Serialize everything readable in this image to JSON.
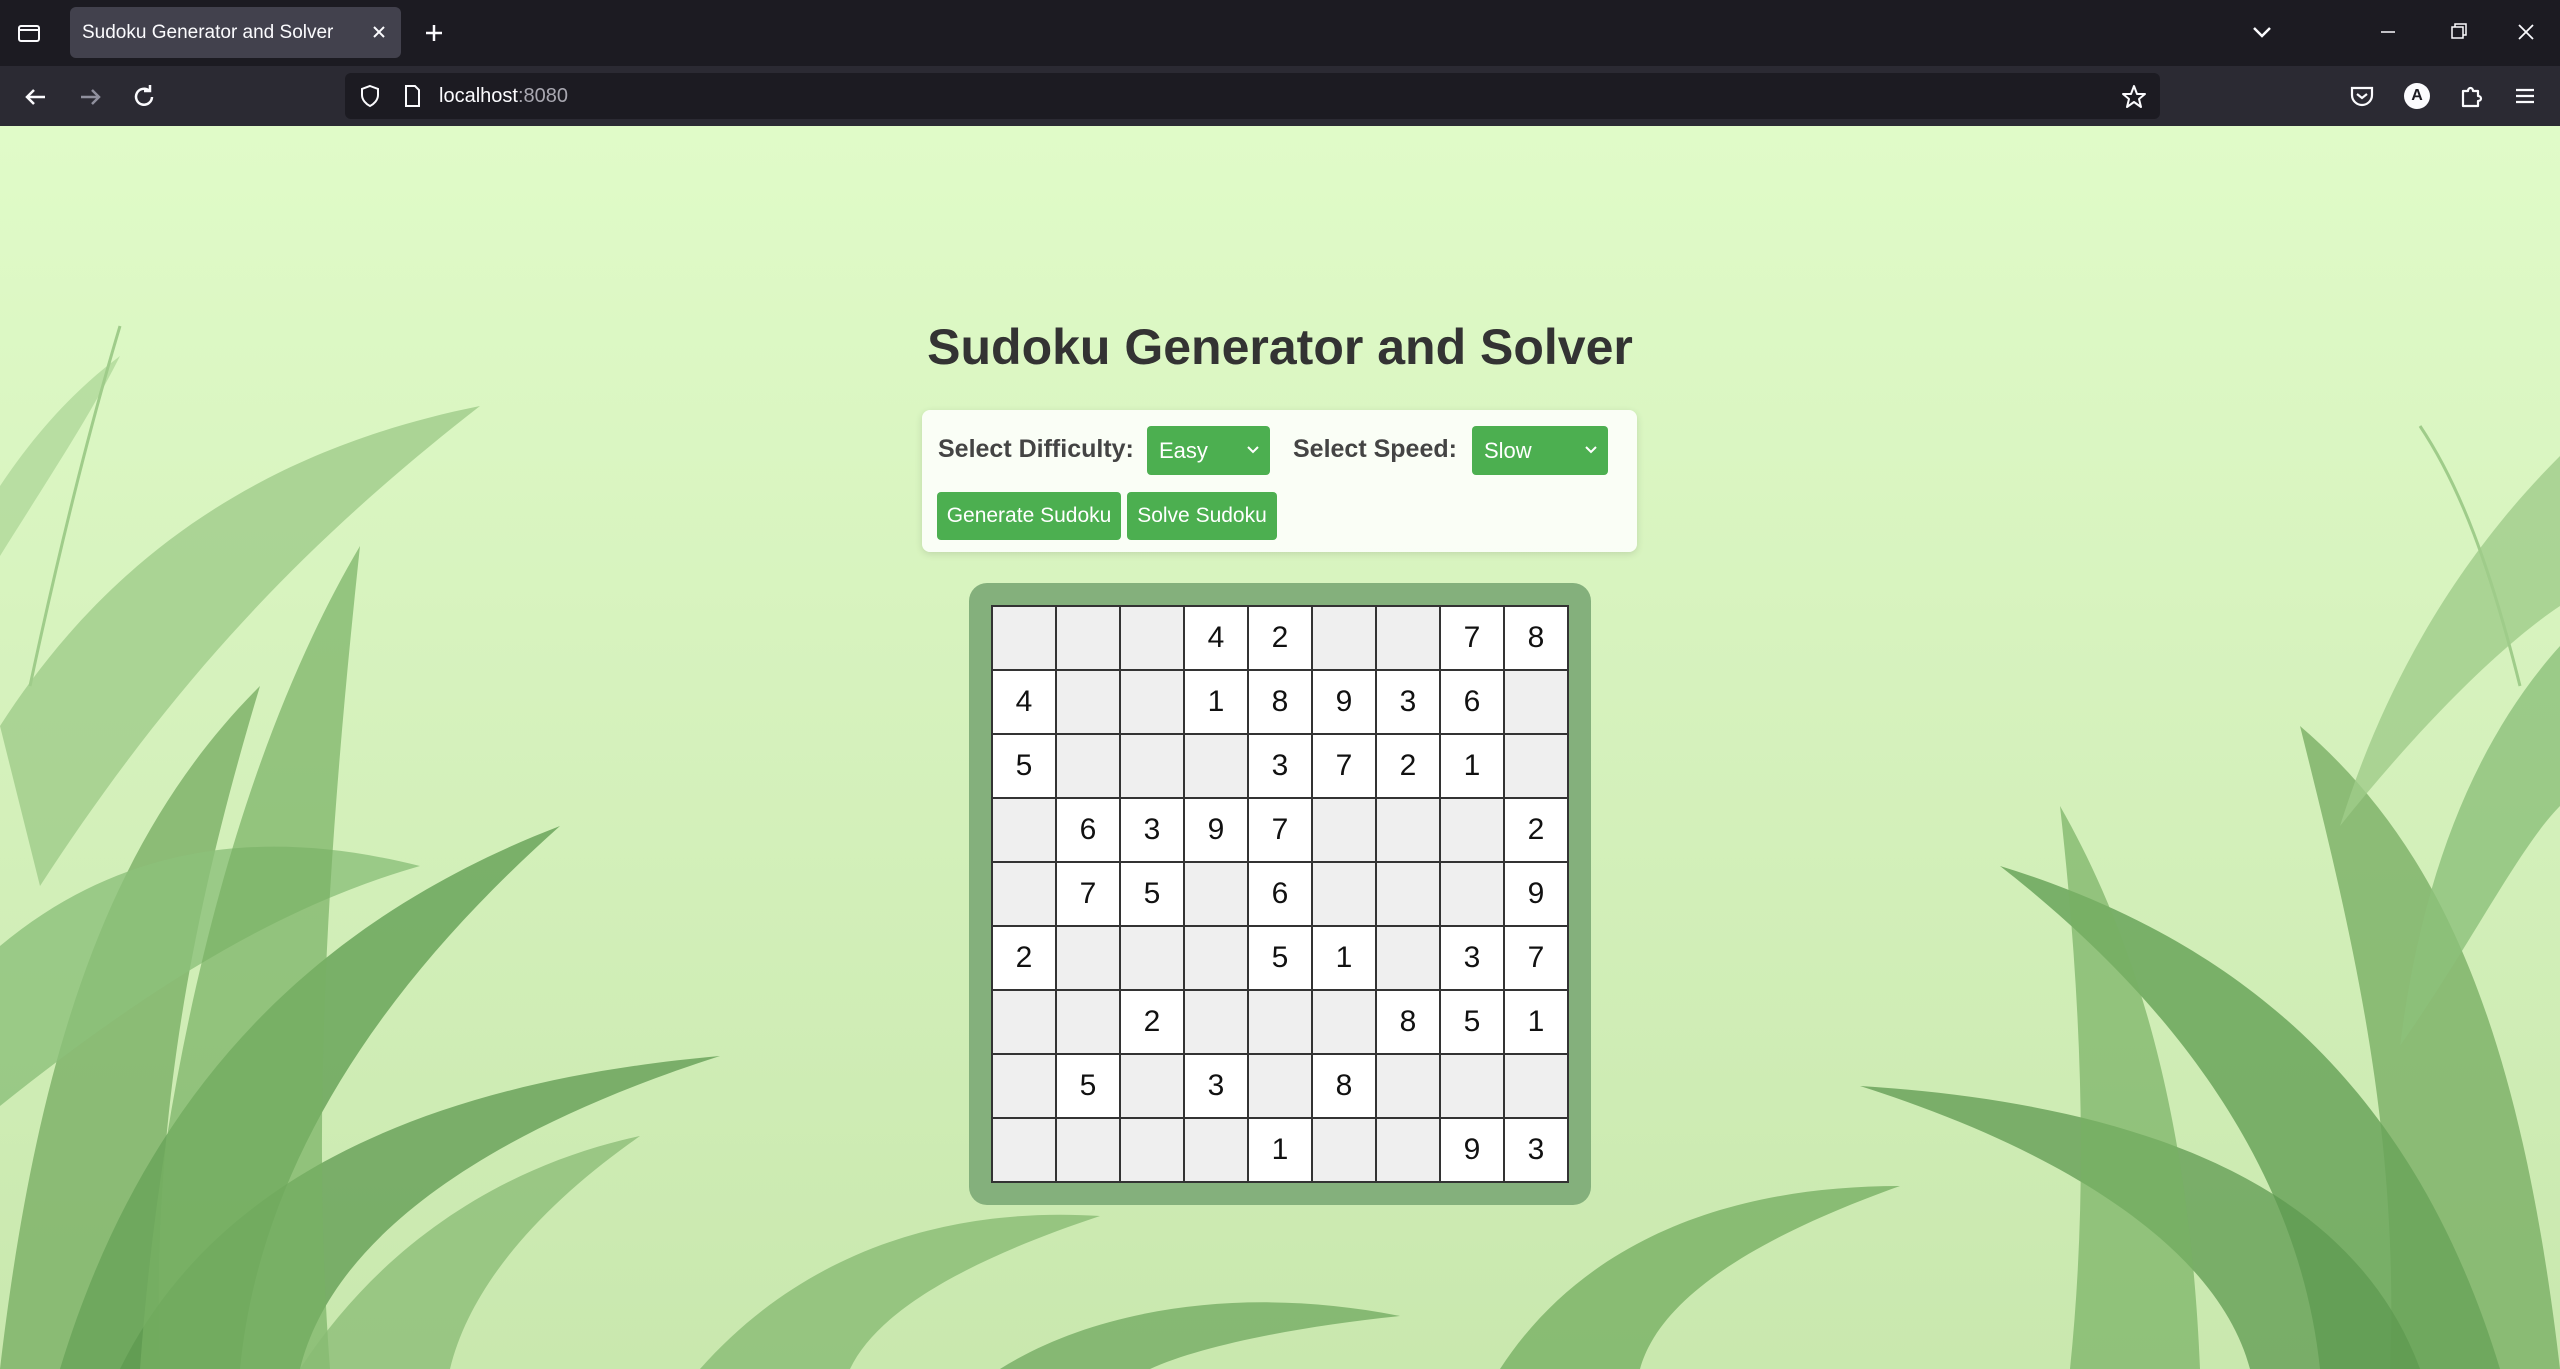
{
  "browser": {
    "tab_title": "Sudoku Generator and Solver",
    "url_host": "localhost",
    "url_port": ":8080",
    "account_initial": "A"
  },
  "page": {
    "title": "Sudoku Generator and Solver",
    "difficulty_label": "Select Difficulty:",
    "difficulty_value": "Easy",
    "speed_label": "Select Speed:",
    "speed_value": "Slow",
    "generate_button": "Generate Sudoku",
    "solve_button": "Solve Sudoku"
  },
  "colors": {
    "accent": "#4caf50",
    "board_frame": "#84b07c",
    "background": "#e0fbc8"
  },
  "sudoku": {
    "grid": [
      [
        "",
        "",
        "",
        "4",
        "2",
        "",
        "",
        "7",
        "8"
      ],
      [
        "4",
        "",
        "",
        "1",
        "8",
        "9",
        "3",
        "6",
        ""
      ],
      [
        "5",
        "",
        "",
        "",
        "3",
        "7",
        "2",
        "1",
        ""
      ],
      [
        "",
        "6",
        "3",
        "9",
        "7",
        "",
        "",
        "",
        "2"
      ],
      [
        "",
        "7",
        "5",
        "",
        "6",
        "",
        "",
        "",
        "9"
      ],
      [
        "2",
        "",
        "",
        "",
        "5",
        "1",
        "",
        "3",
        "7"
      ],
      [
        "",
        "",
        "2",
        "",
        "",
        "",
        "8",
        "5",
        "1"
      ],
      [
        "",
        "5",
        "",
        "3",
        "",
        "8",
        "",
        "",
        ""
      ],
      [
        "",
        "",
        "",
        "",
        "1",
        "",
        "",
        "9",
        "3"
      ]
    ]
  }
}
